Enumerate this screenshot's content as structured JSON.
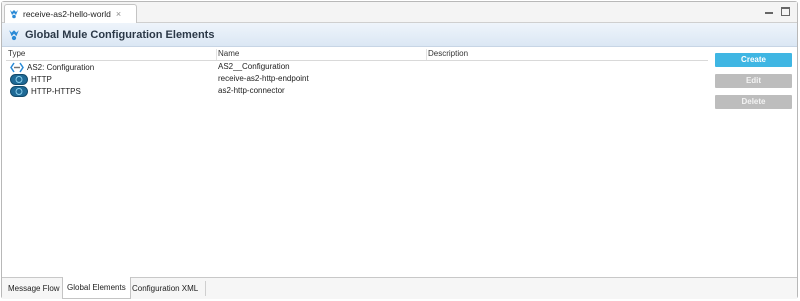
{
  "editor_tab": {
    "label": "receive-as2-hello-world",
    "close_glyph": "×",
    "icon": "mule-icon"
  },
  "header": {
    "title": "Global Mule Configuration Elements",
    "icon": "mule-icon"
  },
  "table": {
    "columns": [
      "Type",
      "Name",
      "Description"
    ],
    "rows": [
      {
        "type": "AS2: Configuration",
        "name": "AS2__Configuration",
        "description": "",
        "icon": "as2-config-icon"
      },
      {
        "type": "HTTP",
        "name": "receive-as2-http-endpoint",
        "description": "",
        "icon": "http-icon"
      },
      {
        "type": "HTTP-HTTPS",
        "name": "as2-http-connector",
        "description": "",
        "icon": "http-https-icon"
      }
    ]
  },
  "buttons": {
    "create": "Create",
    "edit": "Edit",
    "delete": "Delete"
  },
  "bottom_tabs": [
    "Message Flow",
    "Global Elements",
    "Configuration XML"
  ],
  "active_bottom_tab": "Global Elements",
  "colors": {
    "accent": "#3fb6e3",
    "disabled": "#bdbdbd",
    "header_band": "#dbe7f4"
  }
}
